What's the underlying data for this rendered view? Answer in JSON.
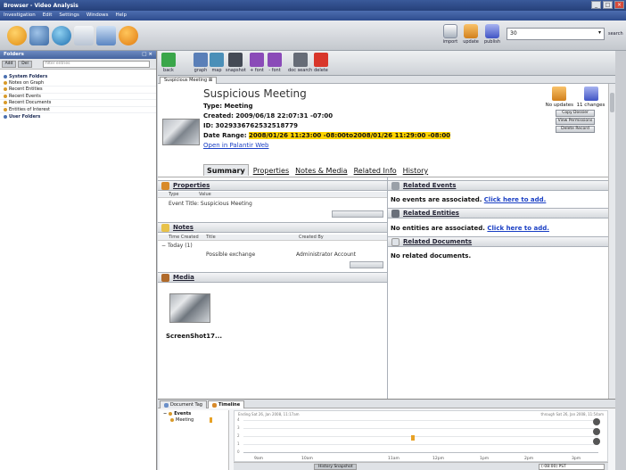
{
  "window": {
    "title": "Browser - Video Analysis",
    "controls": [
      "_",
      "□",
      "×"
    ]
  },
  "menu": [
    "Investigation",
    "Edit",
    "Settings",
    "Windows",
    "Help"
  ],
  "top_right": {
    "tools": [
      "import",
      "update",
      "publish"
    ],
    "search_value": "30",
    "search_label": "search"
  },
  "left_panel": {
    "title": "Folders",
    "filter_placeholder": "filter entries",
    "tool_buttons": [
      "Add",
      "Del"
    ],
    "groups": [
      {
        "label": "System Folders",
        "items": [
          "Notes on Graph",
          "Recent Entities",
          "Recent Events",
          "Recent Documents",
          "Entities of Interest"
        ]
      },
      {
        "label": "User Folders",
        "items": []
      }
    ]
  },
  "main_toolbar": [
    {
      "label": "back",
      "color": "#3aa64a"
    },
    {
      "label": "graph",
      "color": "#5a7fb8"
    },
    {
      "label": "map",
      "color": "#4a8fb8"
    },
    {
      "label": "snapshot",
      "color": "#444a55"
    },
    {
      "label": "+ font",
      "color": "#8a4ab8"
    },
    {
      "label": "- font",
      "color": "#8a4ab8"
    },
    {
      "label": "doc search",
      "color": "#666c77"
    },
    {
      "label": "delete",
      "color": "#d8362a"
    }
  ],
  "doc_tab": "Suspicious Meeting",
  "record": {
    "title": "Suspicious Meeting",
    "type_label": "Type:",
    "type_value": "Meeting",
    "created_label": "Created:",
    "created_value": "2009/06/18 22:07:31 -07:00",
    "id_label": "ID:",
    "id_value": "3029336762532518779",
    "date_label": "Date Range:",
    "date_start": "2008/01/26 11:23:00 -08:00",
    "date_to": "to",
    "date_end": "2008/01/26 11:29:00 -08:00",
    "open_link": "Open in Palantir Web"
  },
  "record_actions": {
    "status_left": "No updates",
    "status_right": "11 changes",
    "buttons": [
      "Copy Dossier",
      "View Permissions",
      "Delete Record"
    ]
  },
  "tabs": [
    "Summary",
    "Properties",
    "Notes & Media",
    "Related Info",
    "History"
  ],
  "properties": {
    "title": "Properties",
    "col_type": "Type",
    "col_value": "Value",
    "row": "Event Title: Suspicious Meeting"
  },
  "notes": {
    "title": "Notes",
    "cols": [
      "Time Created",
      "Title",
      "Created By"
    ],
    "group": "Today (1)",
    "row_title": "Possible exchange",
    "row_author": "Administrator Account"
  },
  "media": {
    "title": "Media",
    "caption": "ScreenShot17..."
  },
  "related_events": {
    "title": "Related Events",
    "text": "No events are associated.",
    "link": "Click here to add."
  },
  "related_entities": {
    "title": "Related Entities",
    "text": "No entities are associated.",
    "link": "Click here to add."
  },
  "related_documents": {
    "title": "Related Documents",
    "text": "No related documents."
  },
  "bottom": {
    "tabs": [
      "Document Tag",
      "Timeline"
    ],
    "tree": [
      "Events",
      "Meeting"
    ],
    "left_caption": "Ending Sat 26, Jan 2008, 11:17am",
    "right_caption": "through Sat 26, Jan 2008, 11:54am",
    "y_ticks": [
      "4",
      "3",
      "2",
      "1",
      "0"
    ],
    "x_ticks": [
      "9am",
      "10am",
      "11am",
      "12pm",
      "1pm",
      "2pm",
      "3pm"
    ],
    "snapshot_label": "History Snapshot",
    "tz_value": "(-08:00) PST"
  }
}
